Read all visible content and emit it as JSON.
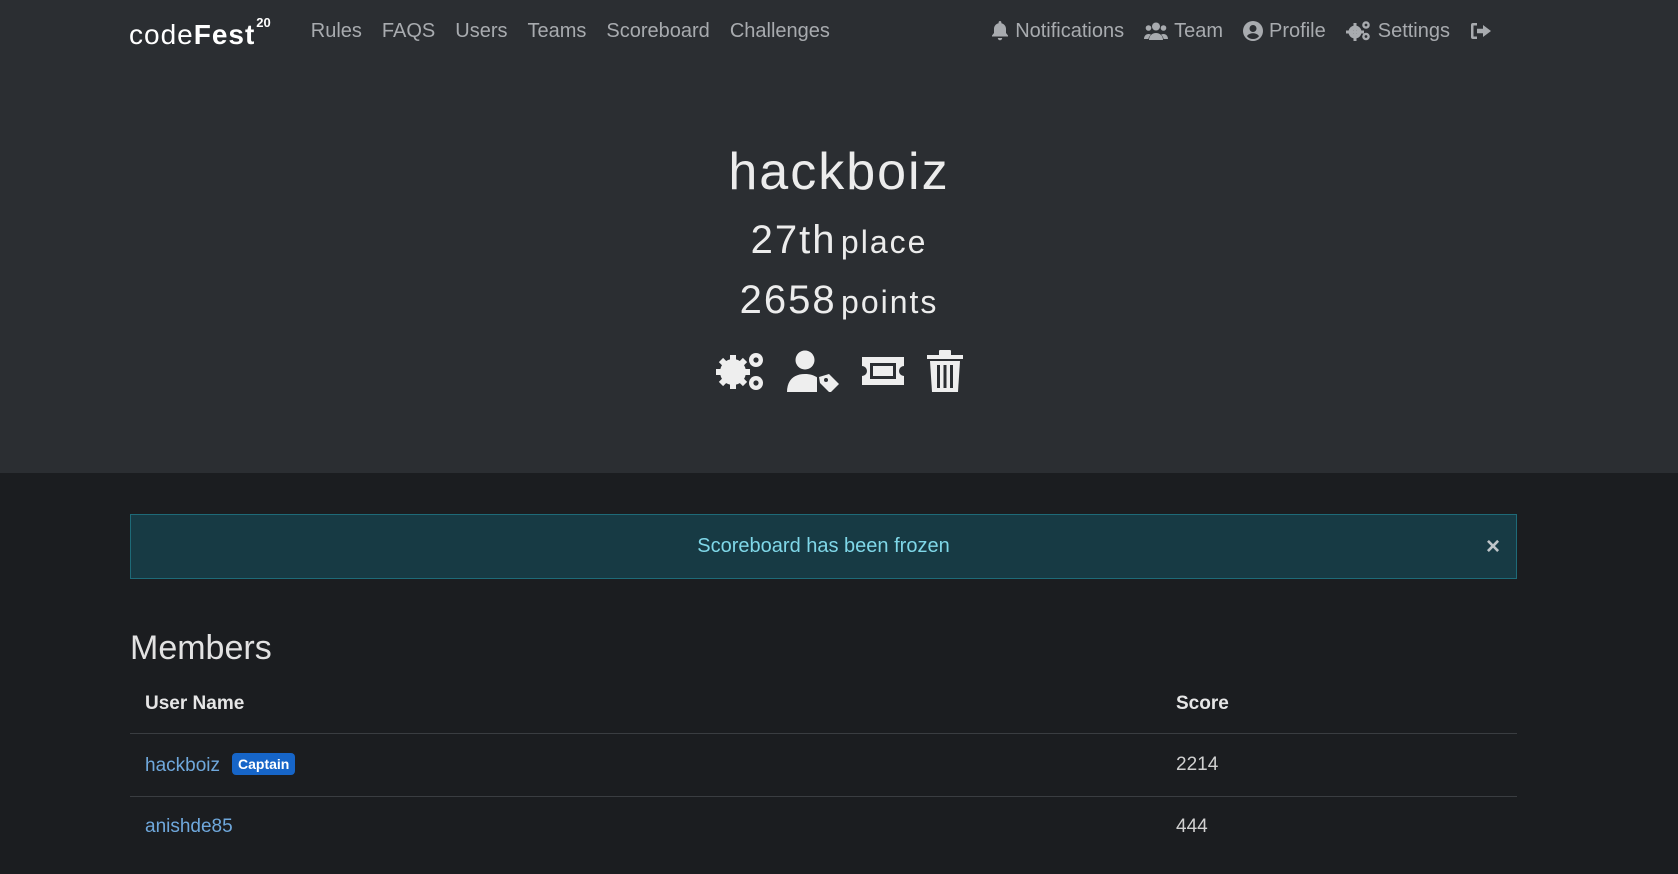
{
  "brand": {
    "code": "code",
    "fest": "Fest",
    "sup": "20"
  },
  "nav": {
    "left": [
      "Rules",
      "FAQS",
      "Users",
      "Teams",
      "Scoreboard",
      "Challenges"
    ],
    "right": [
      {
        "label": "Notifications",
        "icon": "bell-icon"
      },
      {
        "label": "Team",
        "icon": "users-icon"
      },
      {
        "label": "Profile",
        "icon": "user-circle-icon"
      },
      {
        "label": "Settings",
        "icon": "gears-icon"
      },
      {
        "label": "",
        "icon": "logout-icon"
      }
    ]
  },
  "team": {
    "name": "hackboiz",
    "place_num": "27th",
    "place_unit": "place",
    "points_num": "2658",
    "points_unit": "points",
    "actions": [
      "gears-icon",
      "user-tag-icon",
      "ticket-icon",
      "trash-icon"
    ]
  },
  "alert": {
    "message": "Scoreboard has been frozen",
    "close": "×"
  },
  "members": {
    "title": "Members",
    "columns": [
      "User Name",
      "Score"
    ],
    "rows": [
      {
        "name": "hackboiz",
        "badge": "Captain",
        "score": "2214"
      },
      {
        "name": "anishde85",
        "badge": "",
        "score": "444"
      }
    ]
  },
  "colors": {
    "top_bg": "#2b2e32",
    "page_bg": "#1b1d20",
    "link": "#6fa8dc",
    "badge": "#1665c8",
    "alert_bg": "#173a44"
  }
}
